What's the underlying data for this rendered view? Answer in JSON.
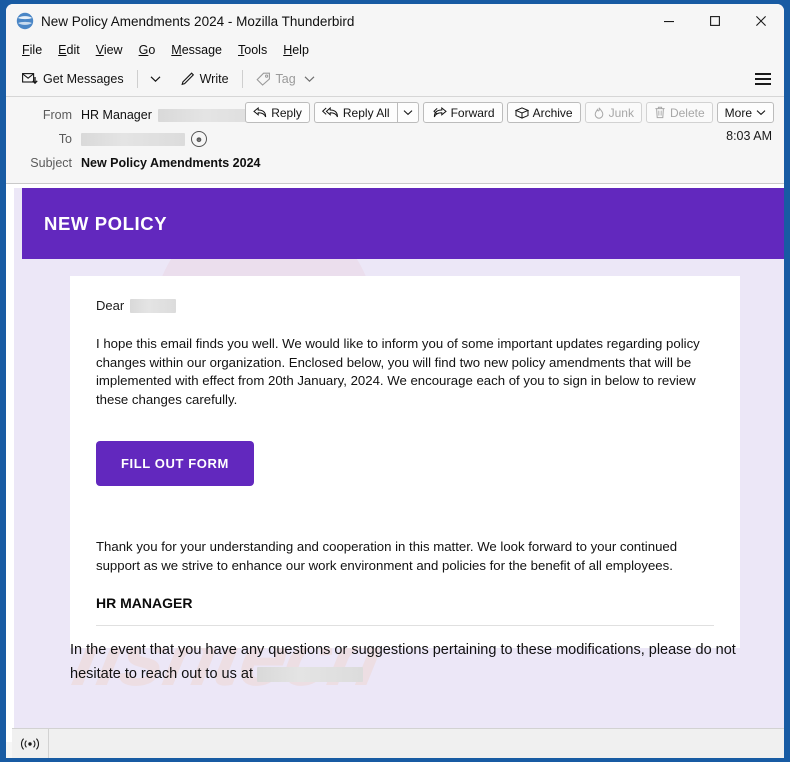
{
  "window": {
    "title": "New Policy Amendments 2024 - Mozilla Thunderbird",
    "app_icon": "thunderbird-icon",
    "controls": {
      "minimize": "minimize-icon",
      "maximize": "maximize-icon",
      "close": "close-icon"
    }
  },
  "menubar": {
    "items": [
      {
        "label": "File",
        "accel": "F"
      },
      {
        "label": "Edit",
        "accel": "E"
      },
      {
        "label": "View",
        "accel": "V"
      },
      {
        "label": "Go",
        "accel": "G"
      },
      {
        "label": "Message",
        "accel": "M"
      },
      {
        "label": "Tools",
        "accel": "T"
      },
      {
        "label": "Help",
        "accel": "H"
      }
    ]
  },
  "toolbar": {
    "get_messages": "Get Messages",
    "write": "Write",
    "tag": "Tag",
    "app_menu": "app-menu-icon"
  },
  "message_header": {
    "from_label": "From",
    "from_value": "HR Manager",
    "from_address_redacted": true,
    "to_label": "To",
    "to_value": "",
    "to_address_redacted": true,
    "subject_label": "Subject",
    "subject_value": "New Policy Amendments 2024",
    "time": "8:03 AM",
    "actions": [
      {
        "label": "Reply",
        "icon": "reply-icon",
        "disabled": false
      },
      {
        "label": "Reply All",
        "icon": "reply-all-icon",
        "disabled": false
      },
      {
        "label": "Forward",
        "icon": "forward-icon",
        "disabled": false
      },
      {
        "label": "Archive",
        "icon": "archive-icon",
        "disabled": false
      },
      {
        "label": "Junk",
        "icon": "junk-icon",
        "disabled": true
      },
      {
        "label": "Delete",
        "icon": "trash-icon",
        "disabled": true
      },
      {
        "label": "More",
        "icon": "chevron-down-icon",
        "disabled": false
      }
    ]
  },
  "email": {
    "banner_title": "NEW POLICY",
    "banner_color": "#6228be",
    "page_background": "#ece7f7",
    "card_background": "#ffffff",
    "greeting": "Dear",
    "greeting_name_redacted": true,
    "paragraph_1": "I hope this email finds you well. We would like to inform you of some important updates regarding policy changes within our organization. Enclosed below, you will find two new policy amendments that will be implemented with effect from 20th January, 2024. We encourage each of you to sign in below to review these changes carefully.",
    "cta_label": "FILL OUT FORM",
    "cta_color": "#6228be",
    "paragraph_2": "Thank you for your understanding and cooperation in this matter. We look forward to your continued support as we strive to enhance our work environment and policies for the benefit of all employees.",
    "signature": "HR MANAGER",
    "outro_text": "In the event that you have any questions or suggestions pertaining to these modifications, please do not hesitate to reach out to us at",
    "outro_email_redacted": true,
    "watermark_text": "fishtech"
  },
  "statusbar": {
    "offline_indicator": "connection-status-icon"
  }
}
